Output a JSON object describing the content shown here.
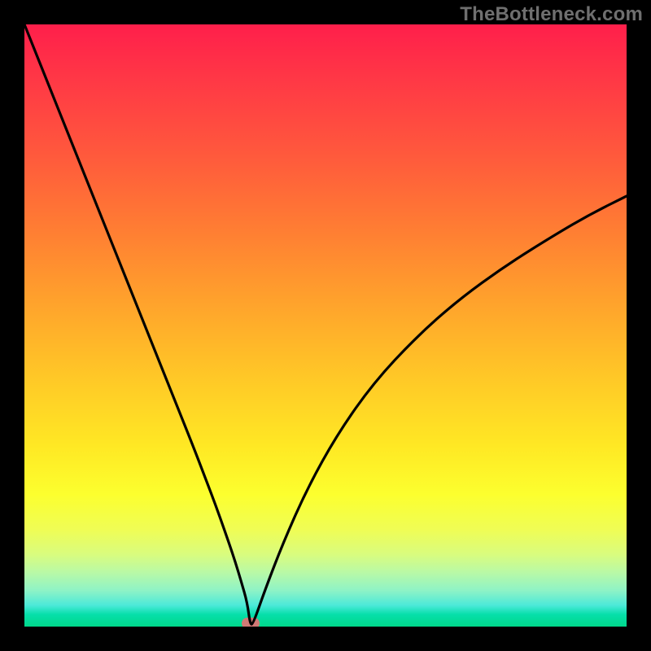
{
  "watermark": "TheBottleneck.com",
  "colors": {
    "frame": "#000000",
    "curve_stroke": "#000000",
    "marker_fill": "#d07a76",
    "watermark_text": "#6f6f6f"
  },
  "chart_data": {
    "type": "line",
    "title": "",
    "xlabel": "",
    "ylabel": "",
    "x": [
      0.0,
      0.05,
      0.1,
      0.15,
      0.2,
      0.25,
      0.28,
      0.3,
      0.32,
      0.34,
      0.35,
      0.36,
      0.37,
      0.375,
      0.38,
      0.4,
      0.43,
      0.47,
      0.52,
      0.58,
      0.65,
      0.72,
      0.8,
      0.88,
      0.94,
      1.0
    ],
    "y": [
      1.0,
      0.875,
      0.75,
      0.625,
      0.5,
      0.375,
      0.3,
      0.248,
      0.195,
      0.138,
      0.108,
      0.075,
      0.04,
      0.003,
      0.005,
      0.062,
      0.14,
      0.23,
      0.32,
      0.405,
      0.48,
      0.542,
      0.6,
      0.65,
      0.685,
      0.715
    ],
    "xlim": [
      0,
      1
    ],
    "ylim": [
      0,
      1
    ],
    "marker_point": {
      "x": 0.376,
      "y": 0.0
    },
    "notes": "Values are fractional positions read off the normalized plot area; x is horizontal fraction left→right, y is vertical fraction bottom→top (0 at bottom). Curve descends steeply from top-left to a minimum near x≈0.376 then rises with a concave-down shape toward the right edge reaching ~0.715."
  }
}
